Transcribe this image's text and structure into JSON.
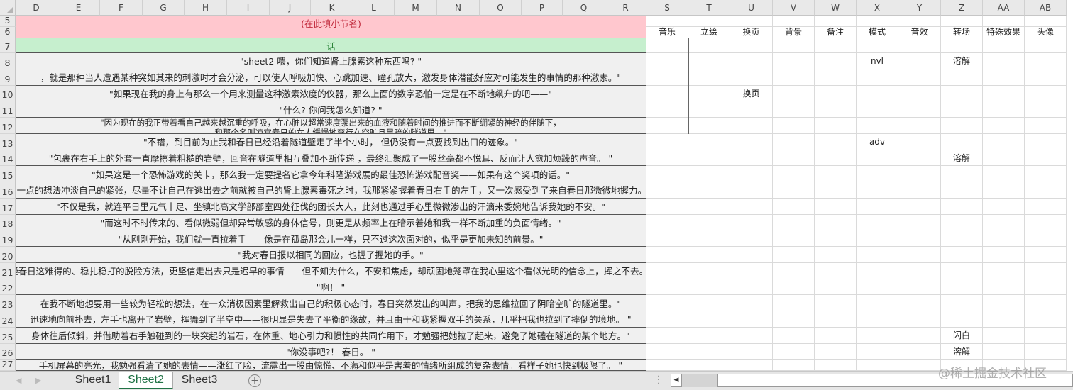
{
  "columns": [
    "D",
    "E",
    "F",
    "G",
    "H",
    "I",
    "J",
    "K",
    "L",
    "M",
    "N",
    "O",
    "P",
    "Q",
    "R",
    "S",
    "T",
    "U",
    "V",
    "W",
    "X",
    "Y",
    "Z",
    "AA",
    "AB"
  ],
  "section_placeholder": "(在此填小节名)",
  "dialogue_header": "话",
  "right_headers": [
    "音乐",
    "立绘",
    "换页",
    "背景",
    "备注",
    "模式",
    "音效",
    "转场",
    "特殊效果",
    "头像"
  ],
  "rows": [
    {
      "num": "8",
      "text": "\"sheet2 喂，你们知道肾上腺素这种东西吗? \"",
      "cells": {
        "X": "nvl",
        "Z": "溶解"
      }
    },
    {
      "num": "9",
      "text": "，就是那种当人遭遇某种突如其来的刺激时才会分泌，可以使人呼吸加快、心跳加速、瞳孔放大，激发身体潜能好应对可能发生的事情的那种激素。\"",
      "cells": {}
    },
    {
      "num": "10",
      "text": "\"如果现在我的身上有那么一个用来测量这种激素浓度的仪器，那么上面的数字恐怕一定是在不断地飙升的吧——\"",
      "cells": {
        "U": "换页"
      }
    },
    {
      "num": "11",
      "text": "\"什么? 你问我怎么知道? \"",
      "cells": {}
    },
    {
      "num": "12",
      "text": "\"因为现在的我正带着看自己越来越沉重的呼吸，在心脏以超常速度泵出来的血液和随着时间的推进而不断绷紧的神经的伴随下，",
      "text2": "和那个名叫凉宫春日的女人缓慢地穿行在空旷且黑暗的隧道里。\"",
      "cells": {}
    },
    {
      "num": "13",
      "text": "\"不错，到目前为止我和春日已经沿着隧道壁走了半个小时， 但仍没有一点要找到出口的迹象。\"",
      "cells": {
        "X": "adv"
      }
    },
    {
      "num": "14",
      "text": "\"包裹在右手上的外套一直摩擦着粗糙的岩壁，回音在隧道里相互叠加不断传递 ，最终汇聚成了一股丝毫都不悦耳、反而让人愈加烦躁的声音。 \"",
      "cells": {
        "Z": "溶解"
      }
    },
    {
      "num": "15",
      "text": "\"如果这是一个恐怖游戏的关卡，那么我一定要提名它拿今年科隆游戏展的最佳恐怖游戏配音奖——如果有这个奖项的话。\"",
      "cells": {}
    },
    {
      "num": "16",
      "text": "松一点的想法冲淡自己的紧张，尽量不让自己在逃出去之前就被自己的肾上腺素毒死之时，我那紧紧握着春日右手的左手，又一次感受到了来自春日那微微地握力。 \"",
      "cells": {}
    },
    {
      "num": "17",
      "text": "\"不仅是我，就连平日里元气十足、坐镇北高文学部部室四处征伐的团长大人，此刻也通过手心里微微渗出的汗滴来委婉地告诉我她的不安。\"",
      "cells": {}
    },
    {
      "num": "18",
      "text": "\"而这时不时传来的、看似微弱但却异常敏感的身体信号，则更是从频率上在暗示着她和我一样不断加重的负面情绪。\"",
      "cells": {}
    },
    {
      "num": "19",
      "text": "\"从刚刚开始，我们就一直拉着手——像是在孤岛那会儿一样，只不过这次面对的，似乎是更加未知的前景。\"",
      "cells": {}
    },
    {
      "num": "20",
      "text": "\"我对春日报以相同的回应，也握了握她的手。\"",
      "cells": {}
    },
    {
      "num": "21",
      "text": "疑春日这难得的、稳扎稳打的脱险方法，更坚信走出去只是迟早的事情——但不知为什么，不安和焦虑，却顽固地笼罩在我心里这个看似光明的信念上，挥之不去。\"",
      "cells": {}
    },
    {
      "num": "22",
      "text": "\"啊！ \"",
      "cells": {}
    },
    {
      "num": "23",
      "text": "在我不断地想要用一些较为轻松的想法，在一众消极因素里解救出自己的积极心态时，春日突然发出的叫声，把我的思维拉回了阴暗空旷的隧道里。\"",
      "cells": {}
    },
    {
      "num": "24",
      "text": "迅速地向前扑去，左手也离开了岩壁，挥舞到了半空中——很明显是失去了平衡的缘故，并且由于和我紧握双手的关系，几乎把我也拉到了摔倒的境地。 \"",
      "cells": {}
    },
    {
      "num": "25",
      "text": "身体往后倾斜，并借助着右手触碰到的一块突起的岩石，在体重、地心引力和惯性的共同作用下，才勉强把她拉了起来，避免了她磕在隧道的某个地方。\"",
      "cells": {
        "Z": "闪白"
      }
    },
    {
      "num": "26",
      "text": "\"你没事吧?！ 春日。 \"",
      "cells": {
        "Z": "溶解"
      }
    },
    {
      "num": "27",
      "text": "手机屏幕的亮光，我勉强看清了她的表情——涨红了脸，流露出一股由惊慌、不满和似乎是害羞的情绪所组成的复杂表情。看样子她也快到极限了。 \"",
      "cells": {}
    }
  ],
  "sheet_tabs": [
    {
      "label": "Sheet1",
      "active": false
    },
    {
      "label": "Sheet2",
      "active": true
    },
    {
      "label": "Sheet3",
      "active": false
    }
  ],
  "watermark": "@稀土掘金技术社区",
  "colors": {
    "section_bg": "#ffc7ce",
    "section_text": "#c0283a",
    "header_bg": "#c6efce",
    "header_text": "#1e7a2c",
    "active_tab": "#217346"
  }
}
